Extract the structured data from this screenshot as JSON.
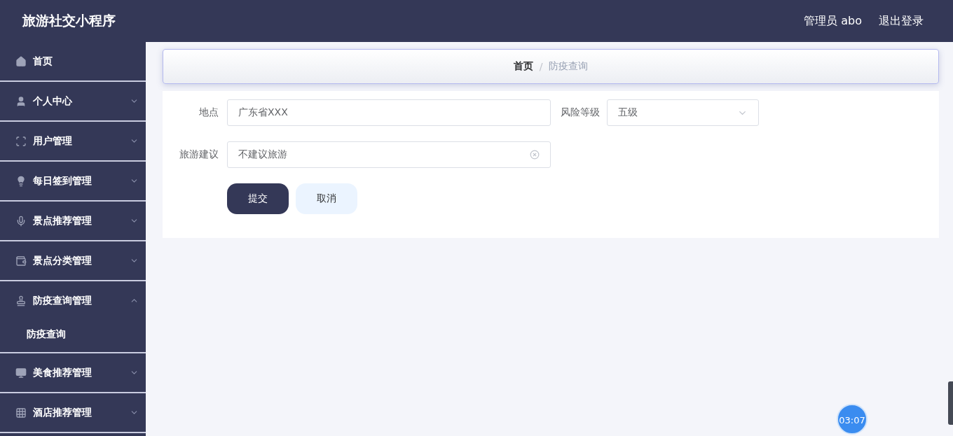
{
  "header": {
    "title": "旅游社交小程序",
    "user": "管理员 abo",
    "logout": "退出登录"
  },
  "sidebar": {
    "items": [
      {
        "label": "首页",
        "kind": "link"
      },
      {
        "label": "个人中心",
        "kind": "menu",
        "expanded": false
      },
      {
        "label": "用户管理",
        "kind": "menu",
        "expanded": false
      },
      {
        "label": "每日签到管理",
        "kind": "menu",
        "expanded": false
      },
      {
        "label": "景点推荐管理",
        "kind": "menu",
        "expanded": false
      },
      {
        "label": "景点分类管理",
        "kind": "menu",
        "expanded": false
      },
      {
        "label": "防疫查询管理",
        "kind": "menu",
        "expanded": true,
        "children": [
          {
            "label": "防疫查询"
          }
        ]
      },
      {
        "label": "美食推荐管理",
        "kind": "menu",
        "expanded": false
      },
      {
        "label": "酒店推荐管理",
        "kind": "menu",
        "expanded": false
      }
    ]
  },
  "breadcrumb_separator": "/",
  "breadcrumb": [
    {
      "label": "首页",
      "current": false
    },
    {
      "label": "防疫查询",
      "current": true
    }
  ],
  "form": {
    "fields": [
      {
        "kind": "input",
        "label": "地点",
        "value": "广东省XXX",
        "clearable": false
      },
      {
        "kind": "select",
        "label": "风险等级",
        "value": "五级"
      },
      {
        "kind": "input",
        "label": "旅游建议",
        "value": "不建议旅游",
        "clearable": true
      }
    ],
    "buttons": [
      {
        "kind": "primary",
        "label": "提交"
      },
      {
        "kind": "secondary",
        "label": "取消"
      }
    ]
  },
  "timer": "03:07"
}
